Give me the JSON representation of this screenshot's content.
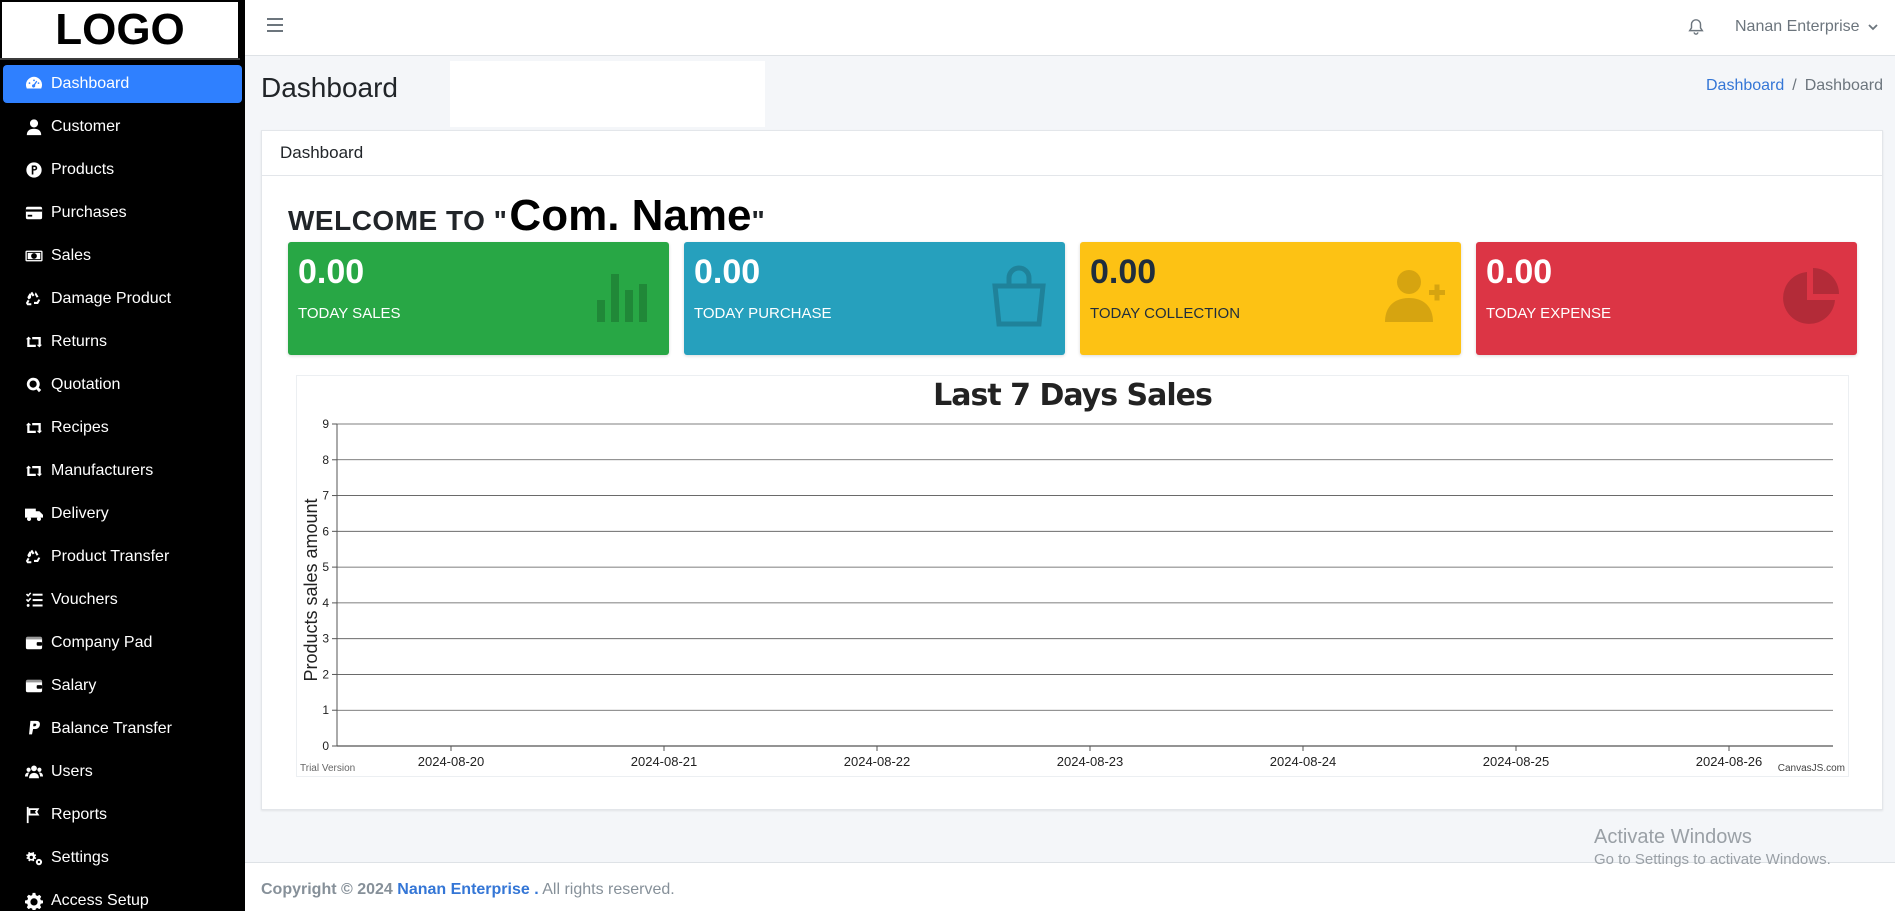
{
  "brand": {
    "logo": "LOGO"
  },
  "sidebar": {
    "items": [
      {
        "label": "Dashboard",
        "icon": "gauge-icon",
        "active": true
      },
      {
        "label": "Customer",
        "icon": "user-icon"
      },
      {
        "label": "Products",
        "icon": "product-p-icon"
      },
      {
        "label": "Purchases",
        "icon": "credit-card-icon"
      },
      {
        "label": "Sales",
        "icon": "money-bill-icon"
      },
      {
        "label": "Damage Product",
        "icon": "recycle-icon"
      },
      {
        "label": "Returns",
        "icon": "retweet-icon"
      },
      {
        "label": "Quotation",
        "icon": "quotation-q-icon"
      },
      {
        "label": "Recipes",
        "icon": "retweet-icon"
      },
      {
        "label": "Manufacturers",
        "icon": "retweet-icon"
      },
      {
        "label": "Delivery",
        "icon": "truck-icon"
      },
      {
        "label": "Product Transfer",
        "icon": "recycle-icon"
      },
      {
        "label": "Vouchers",
        "icon": "list-check-icon"
      },
      {
        "label": "Company Pad",
        "icon": "wallet-icon"
      },
      {
        "label": "Salary",
        "icon": "wallet-icon"
      },
      {
        "label": "Balance Transfer",
        "icon": "paypal-icon"
      },
      {
        "label": "Users",
        "icon": "users-icon"
      },
      {
        "label": "Reports",
        "icon": "flag-icon"
      },
      {
        "label": "Settings",
        "icon": "gears-icon"
      },
      {
        "label": "Access Setup",
        "icon": "gear-icon"
      }
    ]
  },
  "header": {
    "user": "Nanan Enterprise"
  },
  "page": {
    "title": "Dashboard",
    "breadcrumb": {
      "link": "Dashboard",
      "sep": "/",
      "current": "Dashboard"
    }
  },
  "card": {
    "header": "Dashboard",
    "welcome_prefix": "WELCOME TO \"",
    "company_name": "Com. Name",
    "welcome_suffix": "\""
  },
  "boxes": [
    {
      "value": "0.00",
      "label": "TODAY SALES",
      "color": "#28a745",
      "icon": "bar-chart-icon"
    },
    {
      "value": "0.00",
      "label": "TODAY PURCHASE",
      "color": "#26a0bd",
      "icon": "shopping-bag-icon"
    },
    {
      "value": "0.00",
      "label": "TODAY COLLECTION",
      "color": "#fdc214",
      "icon": "user-plus-icon"
    },
    {
      "value": "0.00",
      "label": "TODAY EXPENSE",
      "color": "#dc3545",
      "icon": "pie-chart-icon"
    }
  ],
  "chart_data": {
    "type": "line",
    "title": "Last 7 Days Sales",
    "ylabel": "Products sales amount",
    "xlabel": "",
    "categories": [
      "2024-08-20",
      "2024-08-21",
      "2024-08-22",
      "2024-08-23",
      "2024-08-24",
      "2024-08-25",
      "2024-08-26"
    ],
    "values": [
      0,
      0,
      0,
      0,
      0,
      0,
      0
    ],
    "ylim": [
      0,
      9
    ],
    "yticks": [
      0,
      1,
      2,
      3,
      4,
      5,
      6,
      7,
      8,
      9
    ],
    "grid": true,
    "credit_left": "Trial Version",
    "credit_right": "CanvasJS.com"
  },
  "footer": {
    "prefix": "Copyright © 2024",
    "company": "Nanan Enterprise .",
    "suffix": "All rights reserved."
  },
  "watermark": {
    "line1": "Activate Windows",
    "line2": "Go to Settings to activate Windows."
  }
}
